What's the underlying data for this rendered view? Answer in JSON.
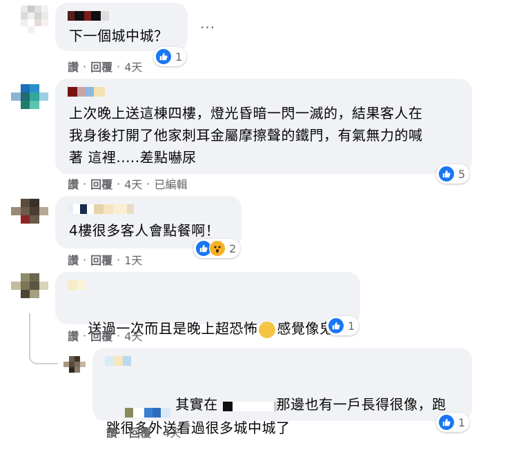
{
  "comments": [
    {
      "text": "下一個城中城？",
      "reactions": {
        "count": "1"
      },
      "meta": {
        "like": "讚",
        "reply": "回覆",
        "time": "4天",
        "edited": ""
      }
    },
    {
      "text": "上次晚上送這棟四樓，燈光昏暗一閃一滅的，結果客人在\n我身後打開了他家刺耳金屬摩擦聲的鐵門，有氣無力的喊\n著 這裡.....差點嚇尿",
      "reactions": {
        "count": "5"
      },
      "meta": {
        "like": "讚",
        "reply": "回覆",
        "time": "4天",
        "edited": "已編輯"
      }
    },
    {
      "text": "4樓很多客人會點餐啊！",
      "reactions": {
        "count": "2"
      },
      "meta": {
        "like": "讚",
        "reply": "回覆",
        "time": "1天",
        "edited": ""
      }
    },
    {
      "text_before": "送過一次而且是晚上超恐怖",
      "text_after": "感覺像鬼屋",
      "reactions": {
        "count": "1"
      },
      "meta": {
        "like": "讚",
        "reply": "回覆",
        "time": "4天",
        "edited": ""
      }
    },
    {
      "text_part1": "其實在",
      "text_part2": "那邊也有一戶長得很像，跑",
      "text_line2": "跳很多外送看過很多城中城了",
      "reactions": {
        "count": "1"
      },
      "meta": {
        "like": "讚",
        "reply": "回覆",
        "time": "4天",
        "edited": ""
      }
    }
  ],
  "more_options": "···",
  "separator": "·",
  "colors": {
    "like": "#1877f2",
    "bubble": "#f0f2f5",
    "meta": "#65676b"
  }
}
